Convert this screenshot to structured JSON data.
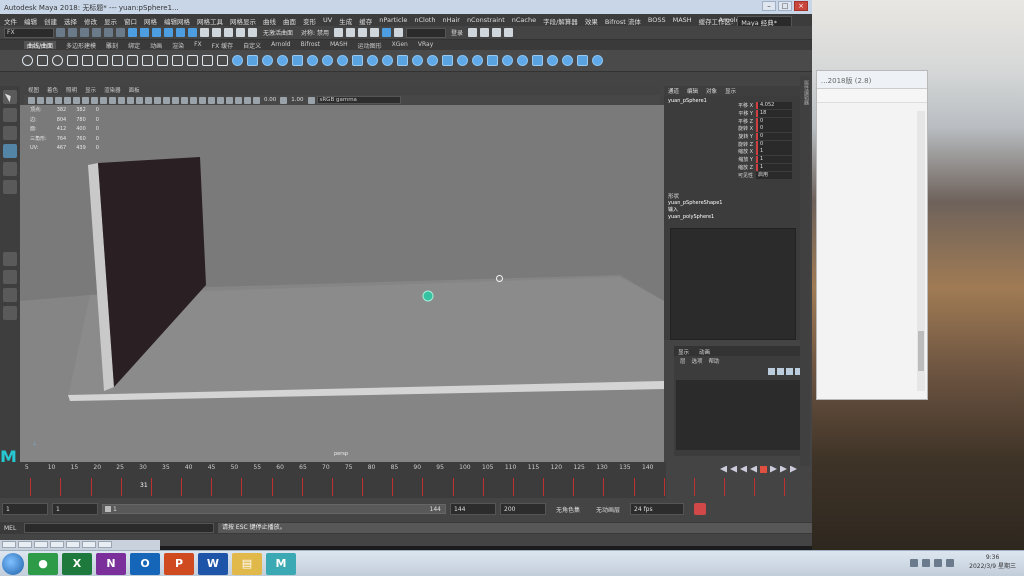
{
  "window": {
    "title": "Autodesk Maya 2018: 无标题*  ---  yuan:pSphere1..."
  },
  "menubar": {
    "items": [
      "文件",
      "编辑",
      "创建",
      "选择",
      "修改",
      "显示",
      "窗口",
      "网格",
      "编辑网格",
      "网格工具",
      "网格显示",
      "曲线",
      "曲面",
      "变形",
      "UV",
      "生成",
      "缓存",
      "nParticle",
      "nCloth",
      "nHair",
      "nConstraint",
      "nCache",
      "字段/解算器",
      "效果",
      "Bifrost 流体",
      "BOSS",
      "MASH",
      "缓存",
      "Arnold",
      "帮助"
    ],
    "workspace_label": "工作区:",
    "workspace_value": "Maya 经典*"
  },
  "statusline": {
    "menu_set": "FX",
    "no_live": "无激活曲面",
    "symmetry": "对称: 禁用",
    "login": "登录"
  },
  "shelf": {
    "tabs": [
      "曲线/曲面",
      "多边形建模",
      "雕刻",
      "绑定",
      "动画",
      "渲染",
      "FX",
      "FX 缓存",
      "自定义",
      "Arnold",
      "Bifrost",
      "MASH",
      "运动图形",
      "XGen",
      "VRay"
    ],
    "active_tab": "曲线/曲面"
  },
  "viewport": {
    "menu": [
      "视图",
      "着色",
      "照明",
      "显示",
      "渲染器",
      "面板"
    ],
    "exposure": "0.00",
    "gamma": "1.00",
    "color_space": "sRGB gamma",
    "camera": "persp",
    "hud_rows": [
      {
        "label": "顶点:",
        "a": "382",
        "b": "382",
        "c": "0"
      },
      {
        "label": "边:",
        "a": "804",
        "b": "780",
        "c": "0"
      },
      {
        "label": "面:",
        "a": "412",
        "b": "400",
        "c": "0"
      },
      {
        "label": "三角形:",
        "a": "764",
        "b": "760",
        "c": "0"
      },
      {
        "label": "UV:",
        "a": "467",
        "b": "439",
        "c": "0"
      }
    ]
  },
  "channel_box": {
    "tabs": [
      "通道",
      "编辑",
      "对象",
      "显示"
    ],
    "object_name": "yuan_pSphere1",
    "attributes": [
      {
        "label": "平移 X",
        "value": "4.052"
      },
      {
        "label": "平移 Y",
        "value": "18"
      },
      {
        "label": "平移 Z",
        "value": "0"
      },
      {
        "label": "旋转 X",
        "value": "0"
      },
      {
        "label": "旋转 Y",
        "value": "0"
      },
      {
        "label": "旋转 Z",
        "value": "0"
      },
      {
        "label": "缩放 X",
        "value": "1"
      },
      {
        "label": "缩放 Y",
        "value": "1"
      },
      {
        "label": "缩放 Z",
        "value": "1"
      },
      {
        "label": "可见性",
        "value": "启用"
      }
    ],
    "shapes_label": "形状",
    "shape_name": "yuan_pSphereShape1",
    "inputs_label": "输入",
    "input_name": "yuan_polySphere1"
  },
  "layer_editor": {
    "tabs": [
      "显示",
      "动画"
    ],
    "menu": [
      "层",
      "选项",
      "帮助"
    ]
  },
  "side_tab": "属性编辑器",
  "timeline": {
    "ticks": [
      "5",
      "10",
      "15",
      "20",
      "25",
      "30",
      "35",
      "40",
      "45",
      "50",
      "55",
      "60",
      "65",
      "70",
      "75",
      "80",
      "85",
      "90",
      "95",
      "100",
      "105",
      "110",
      "115",
      "120",
      "125",
      "130",
      "135",
      "140"
    ],
    "current_frame": "31",
    "key_frames": [
      3,
      6,
      9,
      12,
      15,
      18,
      21,
      24,
      27,
      30,
      33,
      36,
      39,
      42,
      45,
      48,
      51,
      54,
      57,
      60,
      63,
      66,
      69,
      72,
      75,
      78
    ]
  },
  "range": {
    "start": "1",
    "anim_start": "1",
    "slider_start": "1",
    "slider_end": "144",
    "anim_end": "144",
    "end": "200",
    "char_set": "无角色集",
    "anim_layer": "无动画层",
    "fps": "24 fps"
  },
  "command_line": {
    "label": "MEL",
    "message": "请按 ESC 键停止播放。"
  },
  "wallpaper_window": {
    "title": "...2018版 (2.8)"
  },
  "taskbar": {
    "apps": [
      {
        "name": "chrome",
        "color": "#2d9b47",
        "glyph": "●"
      },
      {
        "name": "excel",
        "color": "#1e7a3c",
        "glyph": "X"
      },
      {
        "name": "onenote",
        "color": "#7a2f9a",
        "glyph": "N"
      },
      {
        "name": "outlook",
        "color": "#1566b8",
        "glyph": "O"
      },
      {
        "name": "powerpoint",
        "color": "#cf4a1f",
        "glyph": "P"
      },
      {
        "name": "word",
        "color": "#1f55a8",
        "glyph": "W"
      },
      {
        "name": "explorer",
        "color": "#e0b94a",
        "glyph": "▤"
      },
      {
        "name": "maya",
        "color": "#3aa9b3",
        "glyph": "M"
      }
    ],
    "time": "9:36",
    "date": "2022/3/9 星期三"
  }
}
